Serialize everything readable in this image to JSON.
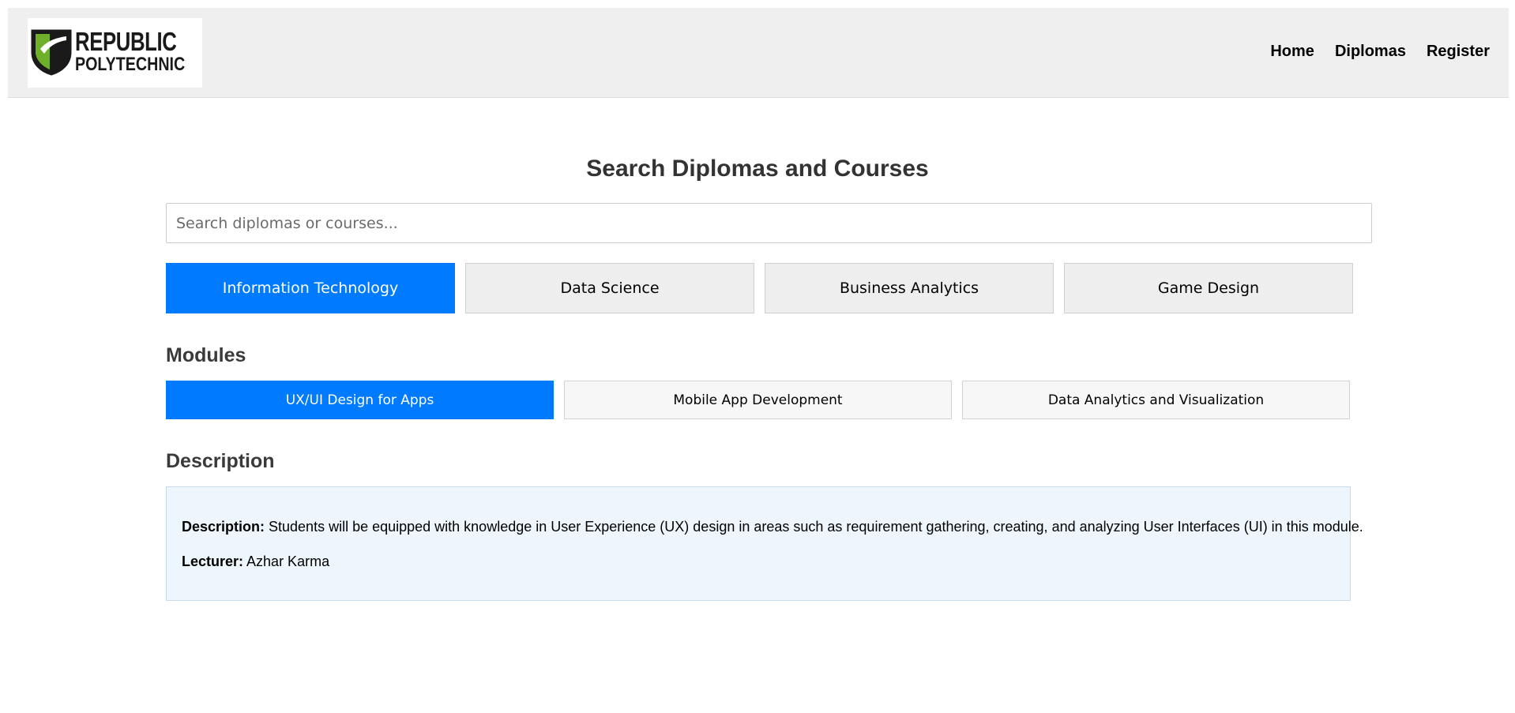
{
  "header": {
    "logo": {
      "line1": "REPUBLIC",
      "line2": "POLYTECHNIC"
    },
    "nav": [
      {
        "label": "Home"
      },
      {
        "label": "Diplomas"
      },
      {
        "label": "Register"
      }
    ]
  },
  "main": {
    "title": "Search Diplomas and Courses",
    "search": {
      "value": "",
      "placeholder": "Search diplomas or courses..."
    },
    "diplomas": [
      {
        "label": "Information Technology",
        "selected": true
      },
      {
        "label": "Data Science",
        "selected": false
      },
      {
        "label": "Business Analytics",
        "selected": false
      },
      {
        "label": "Game Design",
        "selected": false
      }
    ],
    "modules_heading": "Modules",
    "modules": [
      {
        "label": "UX/UI Design for Apps",
        "selected": true
      },
      {
        "label": "Mobile App Development",
        "selected": false
      },
      {
        "label": "Data Analytics and Visualization",
        "selected": false
      }
    ],
    "description_heading": "Description",
    "description": {
      "desc_label": "Description:",
      "desc_text": " Students will be equipped with knowledge in User Experience (UX) design in areas such as requirement gathering, creating, and analyzing User Interfaces (UI) in this module.",
      "lecturer_label": "Lecturer:",
      "lecturer_text": " Azhar Karma"
    }
  },
  "colors": {
    "accent": "#007bff",
    "header_bg": "#efefef",
    "description_bg": "#eef6fd",
    "logo_green": "#6fb02b"
  },
  "icons": {
    "logo": "republic-polytechnic-shield-icon"
  }
}
